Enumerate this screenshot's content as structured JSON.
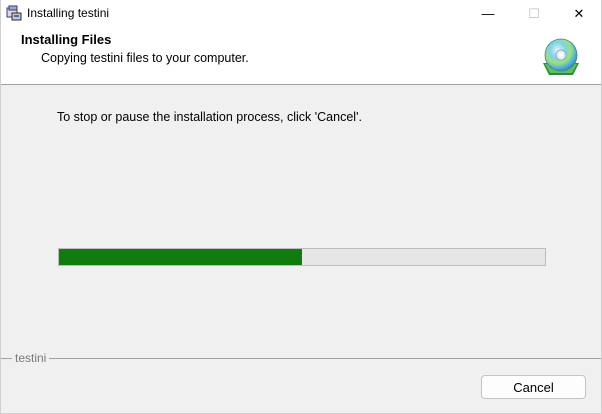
{
  "window": {
    "title": "Installing testini"
  },
  "caption_buttons": {
    "minimize_symbol": "—",
    "maximize_symbol": "☐",
    "close_symbol": "✕"
  },
  "banner": {
    "title": "Installing Files",
    "subtitle": "Copying testini files to your computer.",
    "icon": "cd-disc-icon"
  },
  "body": {
    "instruction": "To stop or pause the installation process, click 'Cancel'.",
    "progress_fraction": 0.5,
    "progress_color": "#107c10"
  },
  "footer": {
    "brand": "testini",
    "cancel_label": "Cancel"
  }
}
